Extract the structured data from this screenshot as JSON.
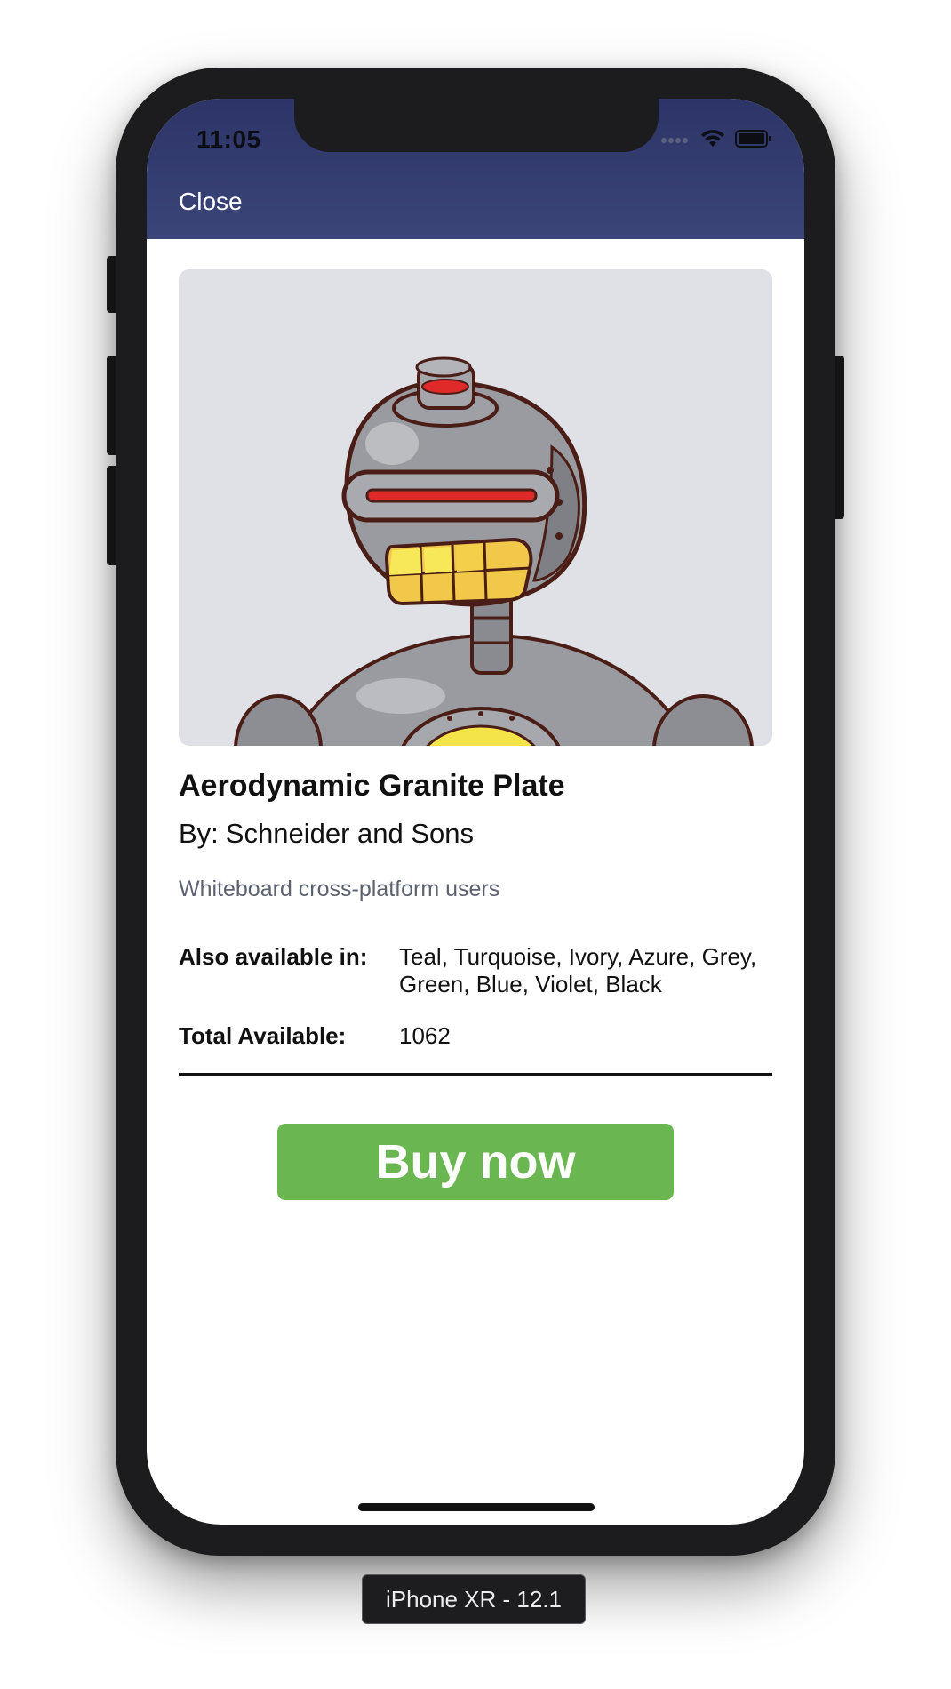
{
  "status_bar": {
    "time": "11:05",
    "icons": [
      "signal-dots-icon",
      "wifi-icon",
      "battery-icon"
    ]
  },
  "nav": {
    "close_label": "Close"
  },
  "product": {
    "image_icon": "robot-illustration-icon",
    "title": "Aerodynamic Granite Plate",
    "vendor_prefix": "By:",
    "vendor": "Schneider and Sons",
    "description": "Whiteboard cross-platform users",
    "details": [
      {
        "label": "Also available in:",
        "value": "Teal, Turquoise, Ivory, Azure, Grey, Green, Blue, Violet, Black"
      },
      {
        "label": "Total Available:",
        "value": "1062"
      }
    ],
    "buy_label": "Buy now"
  },
  "device_label": "iPhone XR - 12.1",
  "colors": {
    "nav_background": "#3c4577",
    "buy_button": "#6ab650",
    "image_background": "#dfe1e6",
    "description_text": "#5c6270"
  }
}
